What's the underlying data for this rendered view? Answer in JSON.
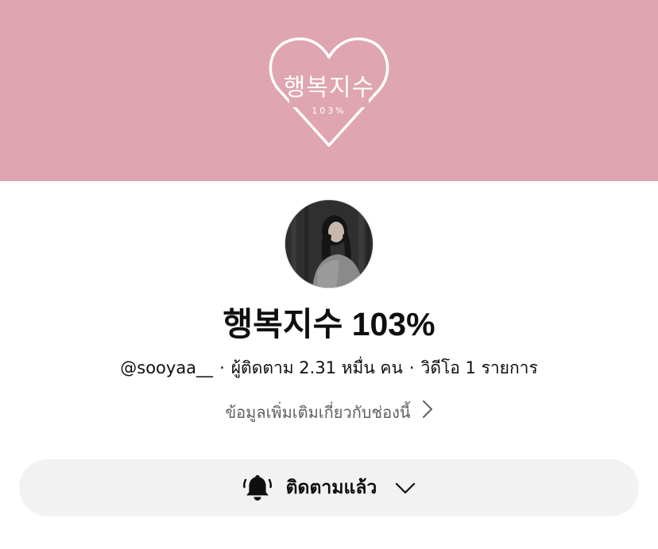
{
  "banner": {
    "background_color": "#dfa5b1",
    "logo_text": "행복지수",
    "logo_subtext": "103%"
  },
  "channel": {
    "title": "행복지수 103%",
    "handle": "@sooyaa__",
    "subscribers": "ผู้ติดตาม 2.31 หมื่น คน",
    "videos": "วิดีโอ 1 รายการ",
    "separator": "·",
    "more_info": "ข้อมูลเพิ่มเติมเกี่ยวกับช่องนี้"
  },
  "subscribe": {
    "label": "ติดตามแล้ว",
    "bell_icon": "bell-icon",
    "dropdown_icon": "chevron-down-icon"
  }
}
